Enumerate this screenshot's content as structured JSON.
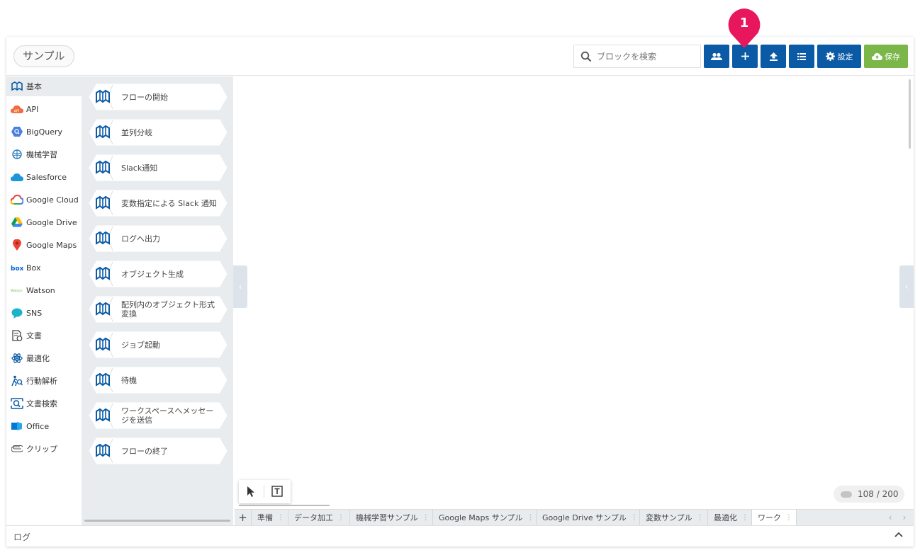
{
  "header": {
    "flow_name": "サンプル",
    "search_placeholder": "ブロックを検索",
    "settings_label": "設定",
    "save_label": "保存",
    "annotation_badge": "1",
    "colors": {
      "primary": "#0a5aa5",
      "save": "#7ab648",
      "badge": "#e8175d"
    }
  },
  "categories": [
    {
      "label": "基本",
      "icon": "basic-block-icon",
      "active": true
    },
    {
      "label": "API",
      "icon": "api-cloud-icon"
    },
    {
      "label": "BigQuery",
      "icon": "bigquery-icon"
    },
    {
      "label": "機械学習",
      "icon": "brain-icon"
    },
    {
      "label": "Salesforce",
      "icon": "salesforce-cloud-icon"
    },
    {
      "label": "Google Cloud",
      "icon": "google-cloud-icon"
    },
    {
      "label": "Google Drive",
      "icon": "google-drive-icon"
    },
    {
      "label": "Google Maps",
      "icon": "map-pin-icon"
    },
    {
      "label": "Box",
      "icon": "box-logo-icon"
    },
    {
      "label": "Watson",
      "icon": "watson-logo-icon"
    },
    {
      "label": "SNS",
      "icon": "chat-bubble-icon"
    },
    {
      "label": "文書",
      "icon": "document-icon"
    },
    {
      "label": "最適化",
      "icon": "atom-icon"
    },
    {
      "label": "行動解析",
      "icon": "runner-icon"
    },
    {
      "label": "文書検索",
      "icon": "document-search-icon"
    },
    {
      "label": "Office",
      "icon": "office-icon"
    },
    {
      "label": "クリップ",
      "icon": "paperclip-icon"
    }
  ],
  "blocks": [
    {
      "label": "フローの開始"
    },
    {
      "label": "並列分岐"
    },
    {
      "label": "Slack通知"
    },
    {
      "label": "変数指定による Slack 通知"
    },
    {
      "label": "ログへ出力"
    },
    {
      "label": "オブジェクト生成"
    },
    {
      "label": "配列内のオブジェクト形式変換"
    },
    {
      "label": "ジョブ起動"
    },
    {
      "label": "待機"
    },
    {
      "label": "ワークスペースへメッセージを送信"
    },
    {
      "label": "フローの終了"
    }
  ],
  "canvas": {
    "block_counter": "108 / 200"
  },
  "tabs": {
    "add_label": "+",
    "items": [
      {
        "label": "準備"
      },
      {
        "label": "データ加工"
      },
      {
        "label": "機械学習サンプル"
      },
      {
        "label": "Google Maps サンプル"
      },
      {
        "label": "Google Drive サンプル"
      },
      {
        "label": "変数サンプル"
      },
      {
        "label": "最適化"
      },
      {
        "label": "ワーク",
        "active": true
      }
    ],
    "menu_glyph": "⋮",
    "prev_glyph": "‹",
    "next_glyph": "›"
  },
  "log": {
    "label": "ログ"
  }
}
